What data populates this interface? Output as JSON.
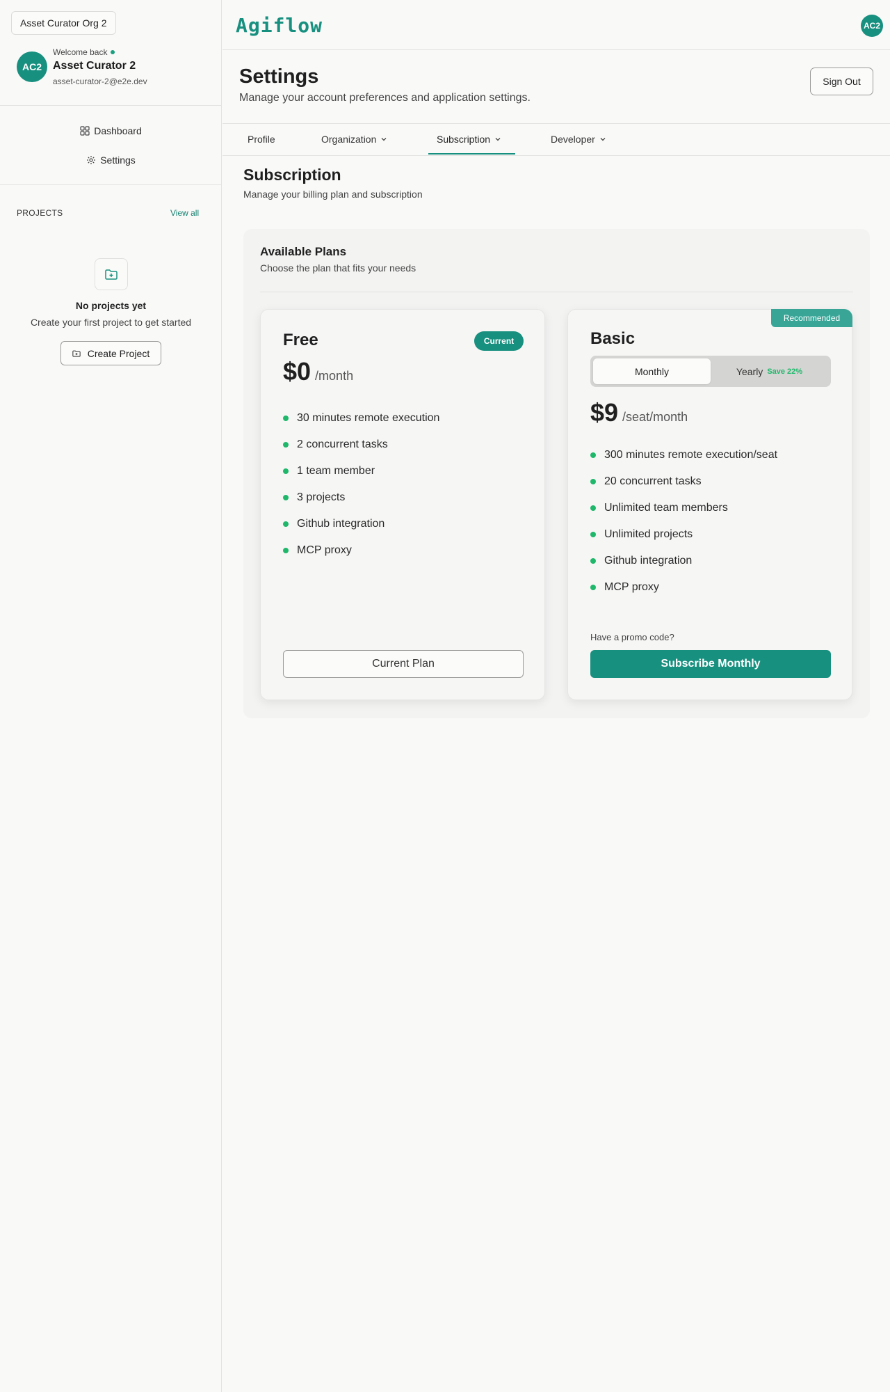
{
  "sidebar": {
    "org_name": "Asset Curator Org 2",
    "user": {
      "initials": "AC2",
      "welcome": "Welcome back",
      "name": "Asset Curator 2",
      "email": "asset-curator-2@e2e.dev"
    },
    "nav": [
      {
        "label": "Dashboard",
        "icon": "grid-icon"
      },
      {
        "label": "Settings",
        "icon": "gear-icon"
      }
    ],
    "projects": {
      "title": "PROJECTS",
      "view_all": "View all",
      "empty_title": "No projects yet",
      "empty_sub": "Create your first project to get started",
      "create_label": "Create Project"
    }
  },
  "topbar": {
    "logo": "Agiflow",
    "avatar_initials": "AC2"
  },
  "header": {
    "title": "Settings",
    "subtitle": "Manage your account preferences and application settings.",
    "signout_label": "Sign Out"
  },
  "tabs": [
    {
      "label": "Profile",
      "has_menu": false,
      "active": false
    },
    {
      "label": "Organization",
      "has_menu": true,
      "active": false
    },
    {
      "label": "Subscription",
      "has_menu": true,
      "active": true
    },
    {
      "label": "Developer",
      "has_menu": true,
      "active": false
    }
  ],
  "subscription": {
    "title": "Subscription",
    "subtitle": "Manage your billing plan and subscription",
    "panel_title": "Available Plans",
    "panel_sub": "Choose the plan that fits your needs",
    "plans": {
      "free": {
        "name": "Free",
        "badge": "Current",
        "price": "$0",
        "period": "/month",
        "features": [
          "30 minutes remote execution",
          "2 concurrent tasks",
          "1 team member",
          "3 projects",
          "Github integration",
          "MCP proxy"
        ],
        "button": "Current Plan"
      },
      "basic": {
        "name": "Basic",
        "ribbon": "Recommended",
        "toggle": {
          "monthly": "Monthly",
          "yearly": "Yearly",
          "save": "Save 22%",
          "selected": "Monthly"
        },
        "price": "$9",
        "period": "/seat/month",
        "features": [
          "300 minutes remote execution/seat",
          "20 concurrent tasks",
          "Unlimited team members",
          "Unlimited projects",
          "Github integration",
          "MCP proxy"
        ],
        "promo": "Have a promo code?",
        "button": "Subscribe Monthly"
      }
    }
  },
  "colors": {
    "accent": "#17907f",
    "feature_dot": "#1fb86b",
    "recommended": "#38a597"
  }
}
